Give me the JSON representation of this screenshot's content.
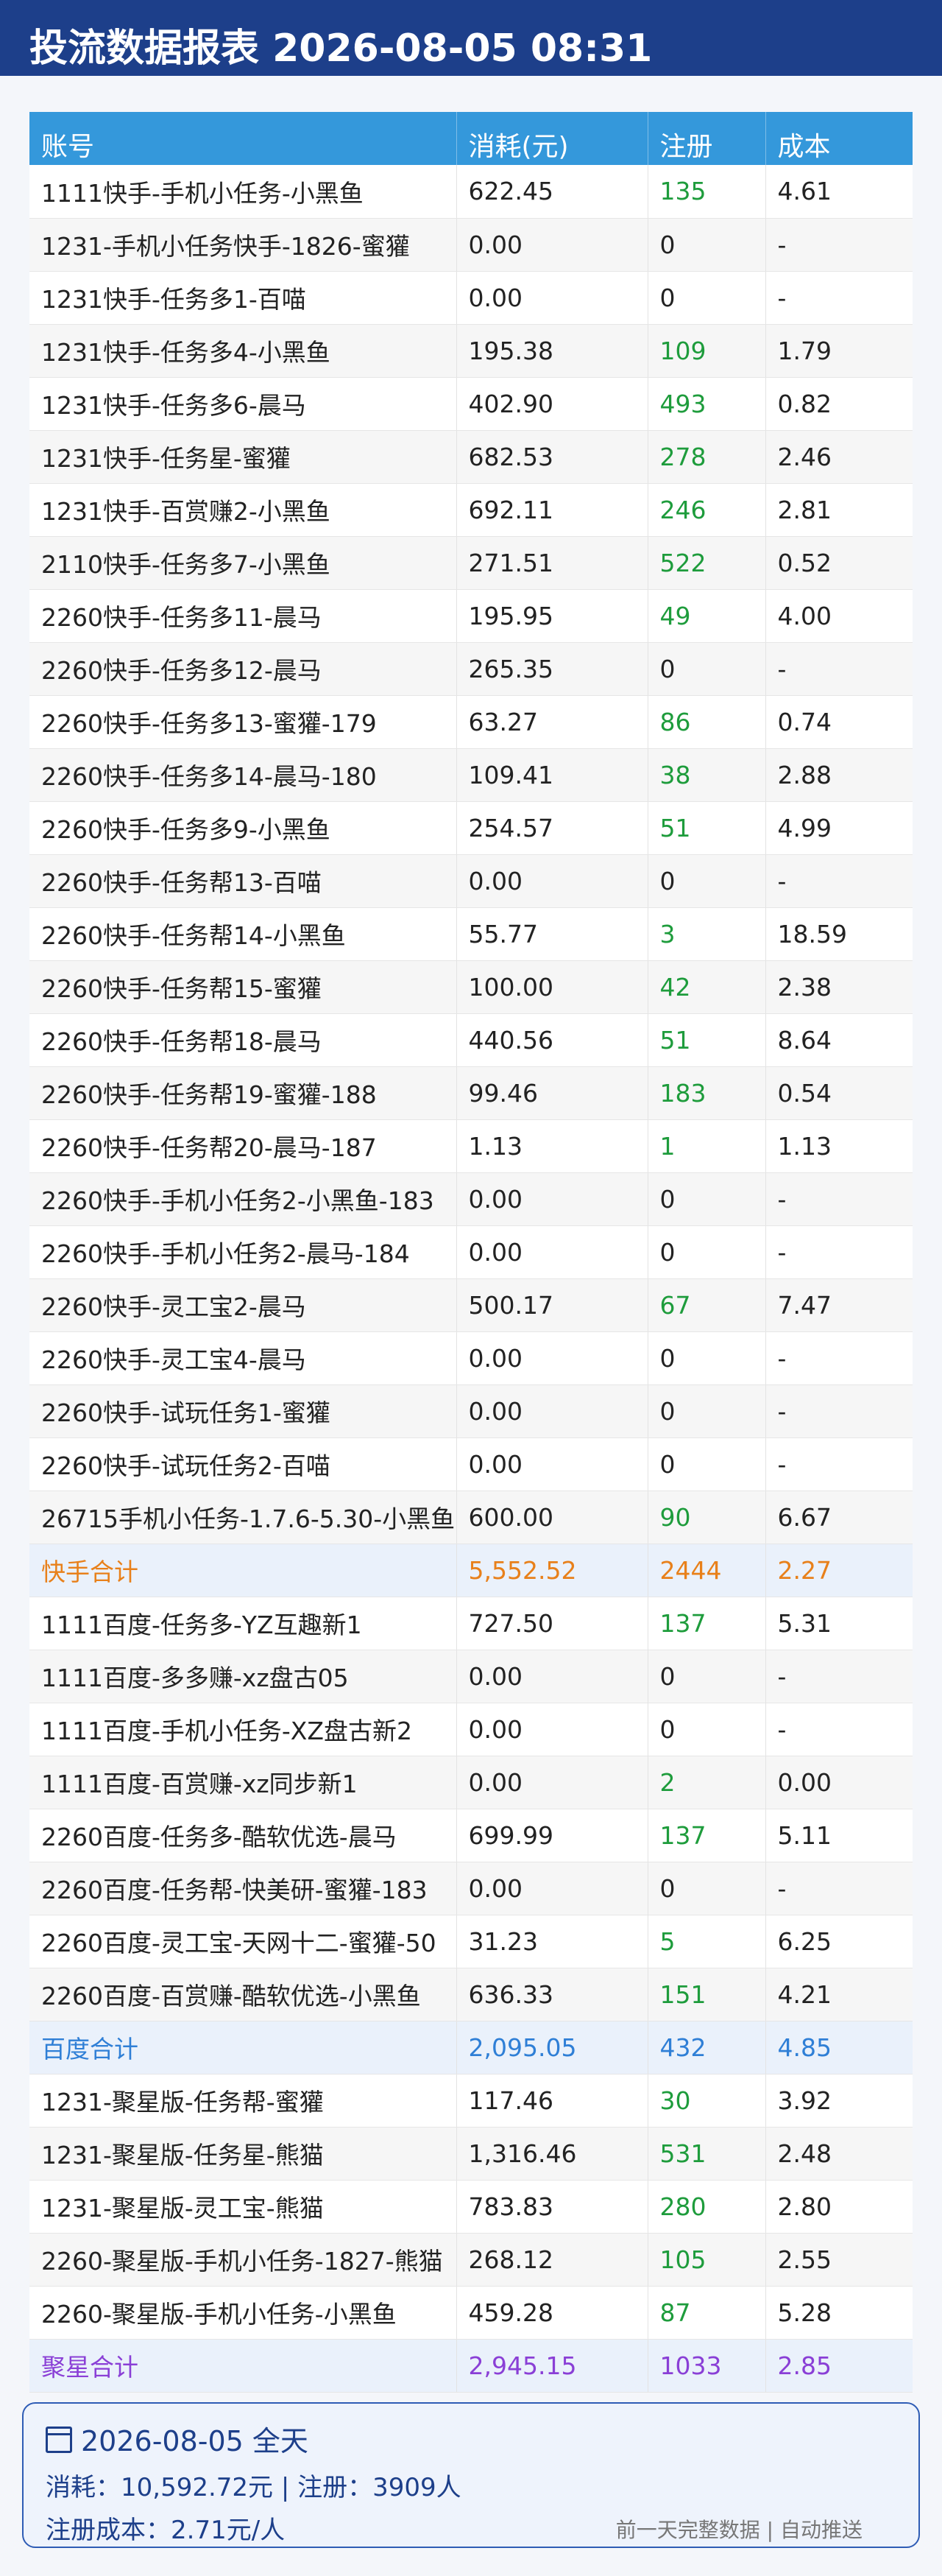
{
  "header": {
    "title": "投流数据报表 2026-08-05 08:31"
  },
  "table": {
    "columns": [
      "账号",
      "消耗(元)",
      "注册",
      "成本"
    ],
    "rows": [
      {
        "account": "1111快手-手机小任务-小黑鱼",
        "spend": "622.45",
        "reg": "135",
        "cost": "4.61"
      },
      {
        "account": "1231-手机小任务快手-1826-蜜獾",
        "spend": "0.00",
        "reg": "0",
        "cost": "-"
      },
      {
        "account": "1231快手-任务多1-百喵",
        "spend": "0.00",
        "reg": "0",
        "cost": "-"
      },
      {
        "account": "1231快手-任务多4-小黑鱼",
        "spend": "195.38",
        "reg": "109",
        "cost": "1.79"
      },
      {
        "account": "1231快手-任务多6-晨马",
        "spend": "402.90",
        "reg": "493",
        "cost": "0.82"
      },
      {
        "account": "1231快手-任务星-蜜獾",
        "spend": "682.53",
        "reg": "278",
        "cost": "2.46"
      },
      {
        "account": "1231快手-百赏赚2-小黑鱼",
        "spend": "692.11",
        "reg": "246",
        "cost": "2.81"
      },
      {
        "account": "2110快手-任务多7-小黑鱼",
        "spend": "271.51",
        "reg": "522",
        "cost": "0.52"
      },
      {
        "account": "2260快手-任务多11-晨马",
        "spend": "195.95",
        "reg": "49",
        "cost": "4.00"
      },
      {
        "account": "2260快手-任务多12-晨马",
        "spend": "265.35",
        "reg": "0",
        "cost": "-"
      },
      {
        "account": "2260快手-任务多13-蜜獾-179",
        "spend": "63.27",
        "reg": "86",
        "cost": "0.74"
      },
      {
        "account": "2260快手-任务多14-晨马-180",
        "spend": "109.41",
        "reg": "38",
        "cost": "2.88"
      },
      {
        "account": "2260快手-任务多9-小黑鱼",
        "spend": "254.57",
        "reg": "51",
        "cost": "4.99"
      },
      {
        "account": "2260快手-任务帮13-百喵",
        "spend": "0.00",
        "reg": "0",
        "cost": "-"
      },
      {
        "account": "2260快手-任务帮14-小黑鱼",
        "spend": "55.77",
        "reg": "3",
        "cost": "18.59"
      },
      {
        "account": "2260快手-任务帮15-蜜獾",
        "spend": "100.00",
        "reg": "42",
        "cost": "2.38"
      },
      {
        "account": "2260快手-任务帮18-晨马",
        "spend": "440.56",
        "reg": "51",
        "cost": "8.64"
      },
      {
        "account": "2260快手-任务帮19-蜜獾-188",
        "spend": "99.46",
        "reg": "183",
        "cost": "0.54"
      },
      {
        "account": "2260快手-任务帮20-晨马-187",
        "spend": "1.13",
        "reg": "1",
        "cost": "1.13"
      },
      {
        "account": "2260快手-手机小任务2-小黑鱼-183",
        "spend": "0.00",
        "reg": "0",
        "cost": "-"
      },
      {
        "account": "2260快手-手机小任务2-晨马-184",
        "spend": "0.00",
        "reg": "0",
        "cost": "-"
      },
      {
        "account": "2260快手-灵工宝2-晨马",
        "spend": "500.17",
        "reg": "67",
        "cost": "7.47"
      },
      {
        "account": "2260快手-灵工宝4-晨马",
        "spend": "0.00",
        "reg": "0",
        "cost": "-"
      },
      {
        "account": "2260快手-试玩任务1-蜜獾",
        "spend": "0.00",
        "reg": "0",
        "cost": "-"
      },
      {
        "account": "2260快手-试玩任务2-百喵",
        "spend": "0.00",
        "reg": "0",
        "cost": "-"
      },
      {
        "account": "26715手机小任务-1.7.6-5.30-小黑鱼",
        "spend": "600.00",
        "reg": "90",
        "cost": "6.67"
      },
      {
        "account": "快手合计",
        "spend": "5,552.52",
        "reg": "2444",
        "cost": "2.27",
        "subtotal": "ks"
      },
      {
        "account": "1111百度-任务多-YZ互趣新1",
        "spend": "727.50",
        "reg": "137",
        "cost": "5.31"
      },
      {
        "account": "1111百度-多多赚-xz盘古05",
        "spend": "0.00",
        "reg": "0",
        "cost": "-"
      },
      {
        "account": "1111百度-手机小任务-XZ盘古新2",
        "spend": "0.00",
        "reg": "0",
        "cost": "-"
      },
      {
        "account": "1111百度-百赏赚-xz同步新1",
        "spend": "0.00",
        "reg": "2",
        "cost": "0.00"
      },
      {
        "account": "2260百度-任务多-酷软优选-晨马",
        "spend": "699.99",
        "reg": "137",
        "cost": "5.11"
      },
      {
        "account": "2260百度-任务帮-快美研-蜜獾-183",
        "spend": "0.00",
        "reg": "0",
        "cost": "-"
      },
      {
        "account": "2260百度-灵工宝-天网十二-蜜獾-50",
        "spend": "31.23",
        "reg": "5",
        "cost": "6.25"
      },
      {
        "account": "2260百度-百赏赚-酷软优选-小黑鱼",
        "spend": "636.33",
        "reg": "151",
        "cost": "4.21"
      },
      {
        "account": "百度合计",
        "spend": "2,095.05",
        "reg": "432",
        "cost": "4.85",
        "subtotal": "bd"
      },
      {
        "account": "1231-聚星版-任务帮-蜜獾",
        "spend": "117.46",
        "reg": "30",
        "cost": "3.92"
      },
      {
        "account": "1231-聚星版-任务星-熊猫",
        "spend": "1,316.46",
        "reg": "531",
        "cost": "2.48"
      },
      {
        "account": "1231-聚星版-灵工宝-熊猫",
        "spend": "783.83",
        "reg": "280",
        "cost": "2.80"
      },
      {
        "account": "2260-聚星版-手机小任务-1827-熊猫",
        "spend": "268.12",
        "reg": "105",
        "cost": "2.55"
      },
      {
        "account": "2260-聚星版-手机小任务-小黑鱼",
        "spend": "459.28",
        "reg": "87",
        "cost": "5.28"
      },
      {
        "account": "聚星合计",
        "spend": "2,945.15",
        "reg": "1033",
        "cost": "2.85",
        "subtotal": "jx"
      }
    ]
  },
  "summary": {
    "icon": "calendar-icon",
    "date_line": "2026-08-05 全天",
    "spend_line": "消耗：10,592.72元 | 注册：3909人",
    "cost_line": "注册成本：2.71元/人",
    "note": "前一天完整数据 | 自动推送"
  },
  "colors": {
    "header_bg": "#1d3f8a",
    "table_header_bg": "#3498db",
    "registration_text": "#1e9c3c",
    "kuaishou_subtotal": "#e8801a",
    "baidu_subtotal": "#2f7fd6",
    "juxing_subtotal": "#8a3fd6"
  }
}
